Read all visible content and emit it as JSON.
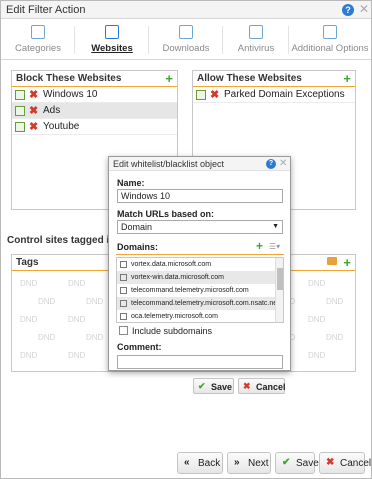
{
  "window": {
    "title": "Edit Filter Action",
    "help": "?",
    "close": "✕"
  },
  "tabs": [
    {
      "label": "Categories",
      "icon": "categories-icon"
    },
    {
      "label": "Websites",
      "icon": "websites-icon",
      "active": true
    },
    {
      "label": "Downloads",
      "icon": "downloads-icon"
    },
    {
      "label": "Antivirus",
      "icon": "antivirus-icon"
    },
    {
      "label": "Additional Options",
      "icon": "additional-options-icon"
    }
  ],
  "block": {
    "title": "Block These Websites",
    "items": [
      "Windows 10",
      "Ads",
      "Youtube"
    ]
  },
  "allow": {
    "title": "Allow These Websites",
    "items": [
      "Parked Domain Exceptions"
    ]
  },
  "control": {
    "label": "Control sites tagged in the W"
  },
  "tags": {
    "title": "Tags",
    "placeholder": "DND"
  },
  "modal": {
    "title": "Edit whitelist/blacklist object",
    "name_label": "Name:",
    "name_value": "Windows 10",
    "match_label": "Match URLs based on:",
    "match_value": "Domain",
    "domains_label": "Domains:",
    "domains": [
      "vortex.data.microsoft.com",
      "vortex-win.data.microsoft.com",
      "telecommand.telemetry.microsoft.com",
      "telecommand.telemetry.microsoft.com.nsatc.net",
      "oca.telemetry.microsoft.com"
    ],
    "include_subdomains": "Include subdomains",
    "comment_label": "Comment:",
    "comment_value": "",
    "save": "Save",
    "cancel": "Cancel"
  },
  "footer": {
    "back": "Back",
    "next": "Next",
    "save": "Save",
    "cancel": "Cancel"
  }
}
